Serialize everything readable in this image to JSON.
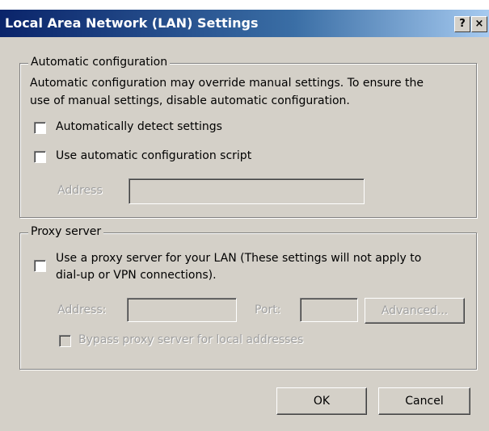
{
  "window": {
    "title": "Local Area Network (LAN) Settings",
    "help_label": "?",
    "close_label": "×"
  },
  "auto_config": {
    "legend": "Automatic configuration",
    "description_line1": "Automatic configuration may override manual settings.  To ensure the",
    "description_line2": "use of manual settings, disable automatic configuration.",
    "detect_label": "Automatically detect settings",
    "detect_checked": false,
    "script_label": "Use automatic configuration script",
    "script_checked": false,
    "address_label": "Address",
    "address_value": ""
  },
  "proxy": {
    "legend": "Proxy server",
    "use_proxy_line1": "Use a proxy server for your LAN (These settings will not apply to",
    "use_proxy_line2": "dial-up or VPN connections).",
    "use_proxy_checked": false,
    "address_label": "Address:",
    "address_value": "",
    "port_label": "Port:",
    "port_value": "",
    "advanced_label": "Advanced...",
    "bypass_label": "Bypass proxy server for local addresses",
    "bypass_checked": false
  },
  "footer": {
    "ok_label": "OK",
    "cancel_label": "Cancel"
  }
}
